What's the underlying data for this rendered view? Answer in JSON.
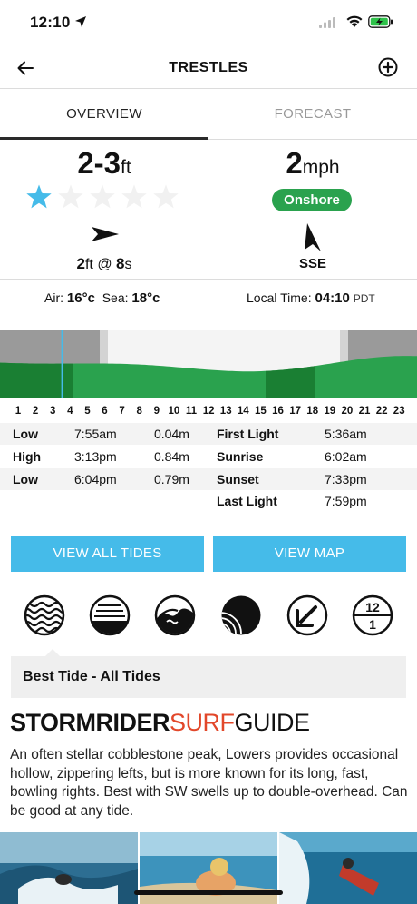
{
  "status_bar": {
    "time": "12:10"
  },
  "nav": {
    "title": "TRESTLES"
  },
  "tabs": [
    {
      "label": "OVERVIEW",
      "active": true
    },
    {
      "label": "FORECAST",
      "active": false
    }
  ],
  "surf": {
    "height_value": "2-3",
    "height_unit": "ft",
    "rating": 1,
    "rating_max": 5,
    "swell_height": "2",
    "swell_height_unit": "ft",
    "swell_sep": "@",
    "swell_period": "8",
    "swell_period_unit": "s"
  },
  "wind": {
    "speed_value": "2",
    "speed_unit": "mph",
    "condition": "Onshore",
    "direction": "SSE"
  },
  "conditions": {
    "air_label": "Air:",
    "air_value": "16°c",
    "sea_label": "Sea:",
    "sea_value": "18°c",
    "local_time_label": "Local Time:",
    "local_time_value": "04:10",
    "timezone": "PDT"
  },
  "tide_chart": {
    "hours": [
      "1",
      "2",
      "3",
      "4",
      "5",
      "6",
      "7",
      "8",
      "9",
      "10",
      "11",
      "12",
      "13",
      "14",
      "15",
      "16",
      "17",
      "18",
      "19",
      "20",
      "21",
      "22",
      "23"
    ],
    "current_hour": 4.2
  },
  "tides": [
    {
      "type": "Low",
      "time": "7:55am",
      "height": "0.04m"
    },
    {
      "type": "High",
      "time": "3:13pm",
      "height": "0.84m"
    },
    {
      "type": "Low",
      "time": "6:04pm",
      "height": "0.79m"
    }
  ],
  "light": [
    {
      "label": "First Light",
      "time": "5:36am"
    },
    {
      "label": "Sunrise",
      "time": "6:02am"
    },
    {
      "label": "Sunset",
      "time": "7:33pm"
    },
    {
      "label": "Last Light",
      "time": "7:59pm"
    }
  ],
  "buttons": {
    "view_all_tides": "VIEW ALL TIDES",
    "view_map": "VIEW MAP"
  },
  "info_icons": [
    "swell-waves-icon",
    "tide-level-icon",
    "wave-break-icon",
    "reef-bottom-icon",
    "swell-direction-icon",
    "clock-tide-icon"
  ],
  "clock_icon_text": {
    "top": "12",
    "bottom": "1"
  },
  "best_tide": {
    "text": "Best Tide - All Tides"
  },
  "guide": {
    "logo_part1": "STORMRIDER",
    "logo_part2": "SURF",
    "logo_part3": "GUIDE",
    "description": "An often stellar cobblestone peak, Lowers provides occasional hollow, zippering lefts, but is more known for its long, fast, bowling rights. Best with SW swells up to double-overhead. Can be good at any tide."
  },
  "colors": {
    "accent_blue": "#45bbe9",
    "onshore_green": "#2aa24e",
    "tide_green": "#1f9d40",
    "logo_red": "#e2472a"
  }
}
